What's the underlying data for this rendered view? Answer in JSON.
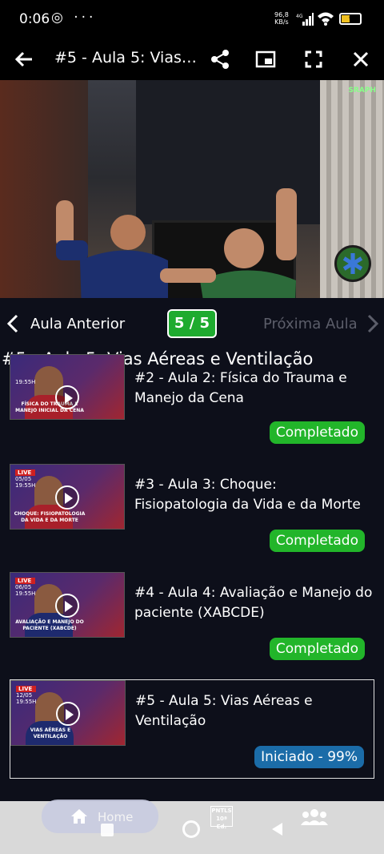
{
  "status_bar": {
    "time": "0:06",
    "left_icons": "◎ ···",
    "net_speed_value": "96,8",
    "net_speed_unit": "KB/s",
    "network": "4G",
    "battery": "63"
  },
  "app_bar": {
    "title": "#5 - Aula 5: Vias Aé...",
    "icons": [
      "back-arrow-icon",
      "share-icon",
      "picture-in-picture-icon",
      "fullscreen-icon",
      "close-icon"
    ]
  },
  "video": {
    "logo_text": "SRAPH"
  },
  "lesson_nav": {
    "prev_label": "Aula Anterior",
    "page": "5 / 5",
    "next_label": "Próxima Aula"
  },
  "lesson_title": "#5 - Aula 5: Vias Aéreas e Ventilação",
  "lessons": [
    {
      "title": "#2 - Aula 2: Física do Trauma e Manejo da Cena",
      "status": "Completado",
      "thumb_caption": "FÍSICA DO TRAUMA E MANEJO INICIAL DA CENA",
      "thumb_date": "19:55H"
    },
    {
      "title": "#3 - Aula 3: Choque: Fisiopatologia da Vida e da Morte",
      "status": "Completado",
      "thumb_caption": "CHOQUE: FISIOPATOLOGIA DA VIDA E DA MORTE",
      "thumb_live": "LIVE",
      "thumb_date": "05/05",
      "thumb_time": "19:55H"
    },
    {
      "title": "#4 - Aula 4: Avaliação e Manejo do paciente (XABCDE)",
      "status": "Completado",
      "thumb_caption": "AVALIAÇÃO E MANEJO DO PACIENTE (XABCDE)",
      "thumb_live": "LIVE",
      "thumb_date": "06/05",
      "thumb_time": "19:55H"
    },
    {
      "title": "#5 - Aula 5: Vias Aéreas e Ventilação",
      "status": "Iniciado - 99%",
      "thumb_caption": "VIAS AÉREAS E VENTILAÇÃO",
      "thumb_live": "LIVE",
      "thumb_date": "12/05",
      "thumb_time": "19:55H"
    }
  ],
  "bottom_nav": {
    "home_label": "Home",
    "pntls_text": "PNTLS 10ª Ed.",
    "items": [
      "home-icon",
      "pntls-book-icon",
      "community-icon"
    ]
  },
  "colors": {
    "background": "#0d0f1a",
    "completed": "#22b52a",
    "started": "#1b6ca8",
    "page_pill": "#1eab2f"
  }
}
